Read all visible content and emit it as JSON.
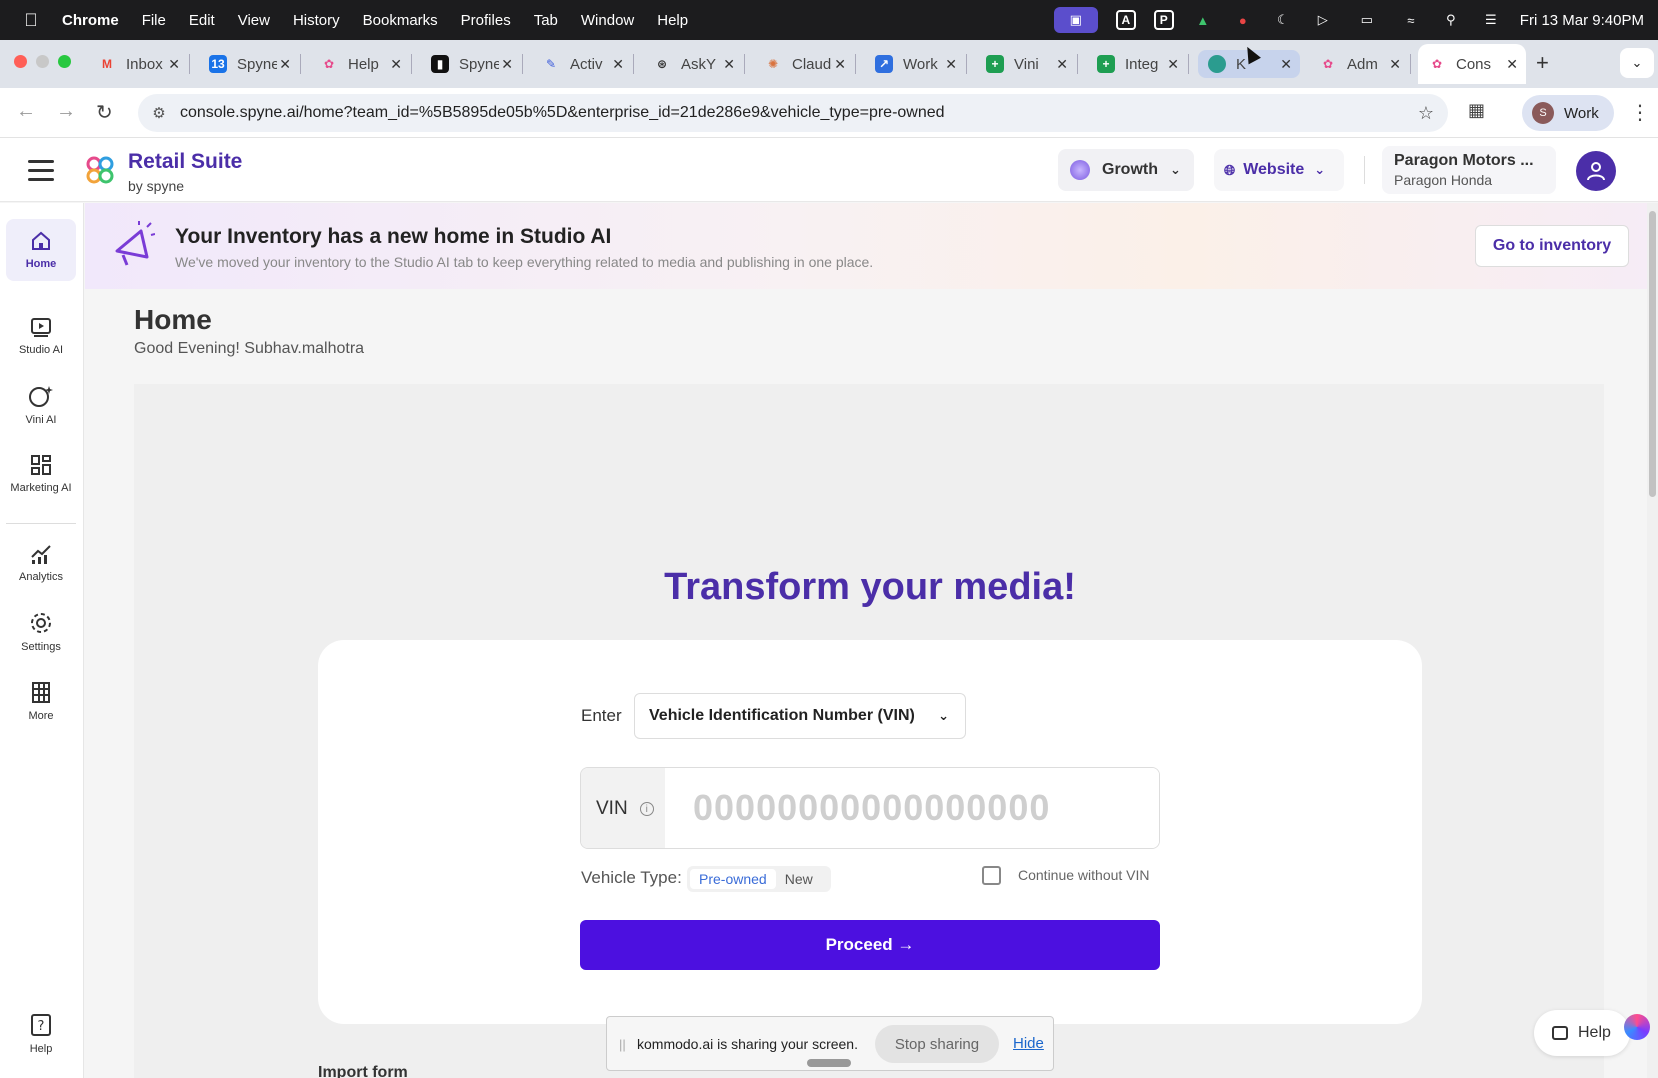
{
  "menubar": {
    "app": "Chrome",
    "items": [
      "File",
      "Edit",
      "View",
      "History",
      "Bookmarks",
      "Profiles",
      "Tab",
      "Window",
      "Help"
    ],
    "clock": "Fri 13 Mar  9:40PM"
  },
  "tabs": [
    {
      "label": "Inbox",
      "fav": "gmail-icon",
      "color": "#ea4335"
    },
    {
      "label": "Spyne",
      "fav": "calendar-icon",
      "color": "#1a73e8"
    },
    {
      "label": "Help",
      "fav": "spyne-icon",
      "color": "#e64a8b"
    },
    {
      "label": "Spyne",
      "fav": "chart-icon",
      "color": "#111111"
    },
    {
      "label": "Activ",
      "fav": "feather-icon",
      "color": "#3b5bdb"
    },
    {
      "label": "AskY",
      "fav": "openai-icon",
      "color": "#333333"
    },
    {
      "label": "Claude",
      "fav": "claude-icon",
      "color": "#d9733f"
    },
    {
      "label": "Work",
      "fav": "workspace-icon",
      "color": "#2f6fdf"
    },
    {
      "label": "Vini",
      "fav": "sheets-icon",
      "color": "#1e9e52"
    },
    {
      "label": "Integ",
      "fav": "sheets-icon",
      "color": "#1e9e52"
    },
    {
      "label": "K",
      "fav": "kommodo-icon",
      "color": "#2b9c8f"
    },
    {
      "label": "Adm",
      "fav": "spyne-icon",
      "color": "#e64a8b"
    },
    {
      "label": "Cons",
      "fav": "spyne-icon",
      "color": "#e64a8b"
    }
  ],
  "address": {
    "url": "console.spyne.ai/home?team_id=%5B5895de05b%5D&enterprise_id=21de286e9&vehicle_type=pre-owned",
    "profile_initial": "S",
    "profile_name": "Work"
  },
  "header": {
    "brand": "Retail Suite",
    "brand_sub": "by spyne",
    "plan": "Growth",
    "website": "Website",
    "dealer_name": "Paragon Motors ...",
    "dealer_sub": "Paragon Honda"
  },
  "sidebar": {
    "items": [
      {
        "label": "Home",
        "icon": "home-icon"
      },
      {
        "label": "Studio AI",
        "icon": "studio-icon"
      },
      {
        "label": "Vini AI",
        "icon": "vini-icon"
      },
      {
        "label": "Marketing AI",
        "icon": "grid-icon"
      },
      {
        "label": "Analytics",
        "icon": "analytics-icon"
      },
      {
        "label": "Settings",
        "icon": "gear-icon"
      },
      {
        "label": "More",
        "icon": "building-icon"
      },
      {
        "label": "Help",
        "icon": "help-icon"
      }
    ]
  },
  "banner": {
    "title": "Your Inventory has a new home in Studio AI",
    "subtitle": "We've moved your inventory to the Studio AI tab to keep everything related to media and publishing in one place.",
    "button": "Go to inventory"
  },
  "main": {
    "title": "Home",
    "greeting": "Good Evening! Subhav.malhotra",
    "hero": "Transform your media!",
    "enter_label": "Enter",
    "select_value": "Vehicle Identification Number (VIN)",
    "vin_label": "VIN",
    "vin_placeholder": "00000000000000000",
    "vehicle_type_label": "Vehicle Type:",
    "vehicle_types": [
      "Pre-owned",
      "New"
    ],
    "continue_label": "Continue without VIN",
    "proceed": "Proceed →",
    "import_label": "Import form"
  },
  "share": {
    "message": "kommodo.ai is sharing your screen.",
    "stop": "Stop sharing",
    "hide": "Hide"
  },
  "help_button": "Help",
  "colors": {
    "accent": "#4c10e0",
    "brand": "#4b2ea8"
  }
}
